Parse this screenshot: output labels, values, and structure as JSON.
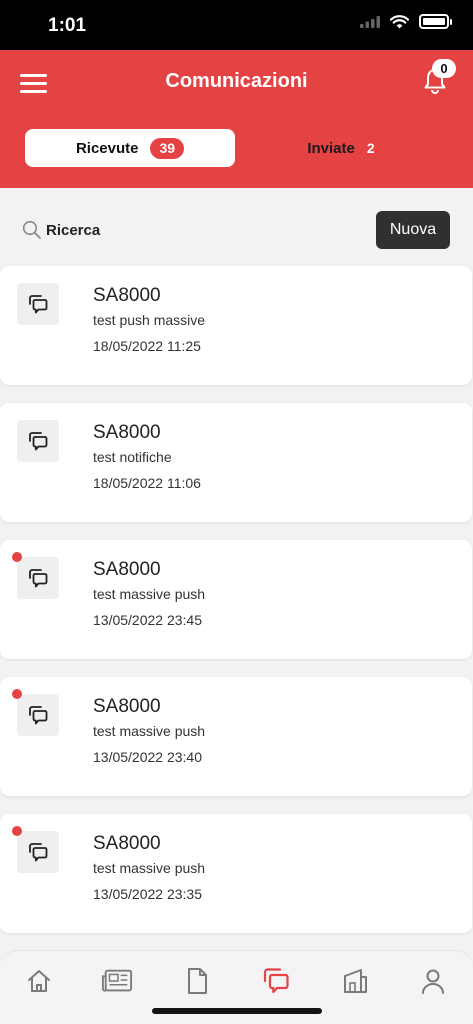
{
  "status_bar": {
    "time": "1:01"
  },
  "header": {
    "title": "Comunicazioni",
    "notification_count": "0"
  },
  "tabs": [
    {
      "label": "Ricevute",
      "count": "39"
    },
    {
      "label": "Inviate",
      "count": "2"
    }
  ],
  "toolbar": {
    "search_label": "Ricerca",
    "new_label": "Nuova"
  },
  "messages": [
    {
      "title": "SA8000",
      "subtitle": "test push massive",
      "date": "18/05/2022 11:25",
      "unread": false
    },
    {
      "title": "SA8000",
      "subtitle": "test notifiche",
      "date": "18/05/2022 11:06",
      "unread": false
    },
    {
      "title": "SA8000",
      "subtitle": "test massive push",
      "date": "13/05/2022 23:45",
      "unread": true
    },
    {
      "title": "SA8000",
      "subtitle": "test massive push",
      "date": "13/05/2022 23:40",
      "unread": true
    },
    {
      "title": "SA8000",
      "subtitle": "test massive push",
      "date": "13/05/2022 23:35",
      "unread": true
    }
  ],
  "bottom_nav": [
    {
      "icon": "home-icon",
      "active": false
    },
    {
      "icon": "newspaper-icon",
      "active": false
    },
    {
      "icon": "document-icon",
      "active": false
    },
    {
      "icon": "chat-icon",
      "active": true
    },
    {
      "icon": "building-icon",
      "active": false
    },
    {
      "icon": "user-icon",
      "active": false
    }
  ],
  "colors": {
    "accent": "#e54343",
    "dark_button": "#303030",
    "nav_inactive": "#7a7a7a"
  }
}
